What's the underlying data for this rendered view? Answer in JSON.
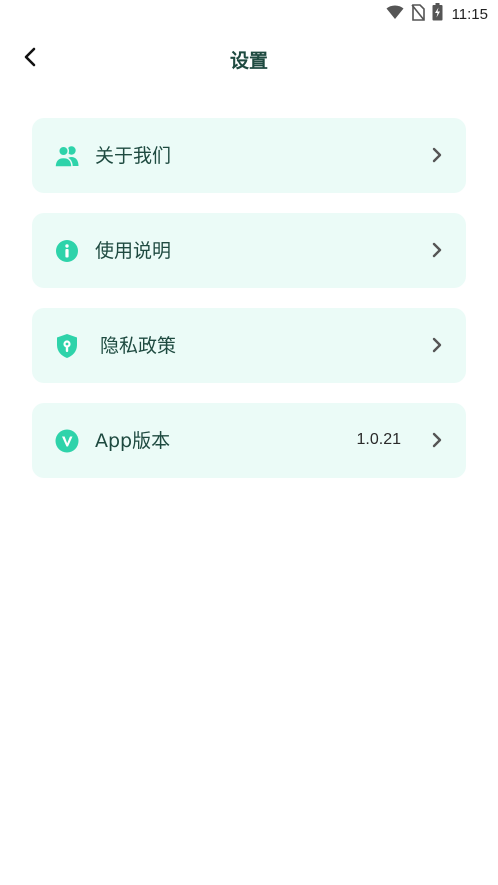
{
  "status_bar": {
    "time": "11:15",
    "icons": [
      "wifi-icon",
      "no-sim-icon",
      "battery-charging-icon"
    ]
  },
  "header": {
    "title": "设置",
    "back_icon": "chevron-left-icon"
  },
  "settings": {
    "items": [
      {
        "label": "关于我们",
        "icon": "users-icon",
        "value": ""
      },
      {
        "label": "使用说明",
        "icon": "info-icon",
        "value": ""
      },
      {
        "label": "隐私政策",
        "icon": "shield-lock-icon",
        "value": ""
      },
      {
        "label": "App版本",
        "icon": "version-v-icon",
        "value": "1.0.21"
      }
    ]
  },
  "colors": {
    "accent": "#2ed3aa",
    "card_bg": "#ebfbf7",
    "title_text": "#1e4a40",
    "chevron": "#555555"
  }
}
